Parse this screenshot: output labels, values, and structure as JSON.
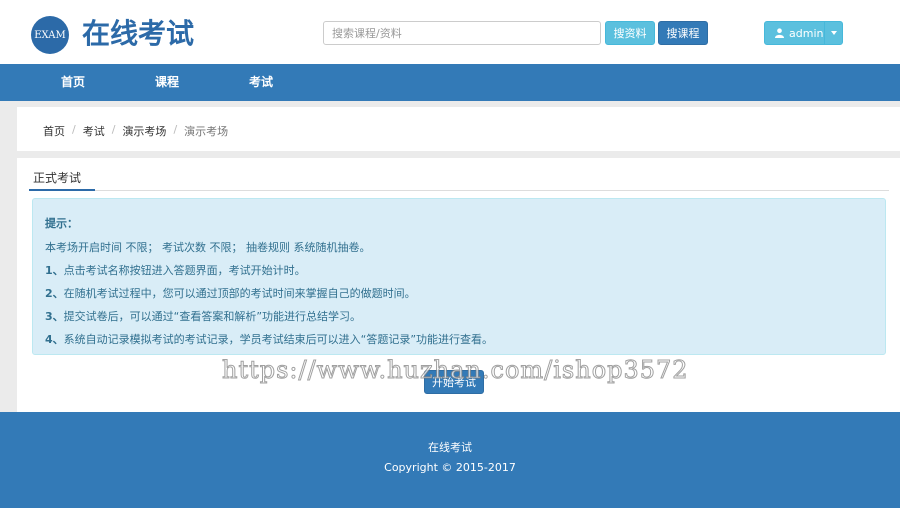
{
  "header": {
    "logo_badge": "EXAM",
    "logo_title": "在线考试",
    "search_placeholder": "搜索课程/资料",
    "search_resources_label": "搜资料",
    "search_courses_label": "搜课程",
    "user_name": "admin"
  },
  "nav": {
    "items": [
      {
        "label": "首页"
      },
      {
        "label": "课程"
      },
      {
        "label": "考试"
      }
    ]
  },
  "breadcrumb": [
    {
      "label": "首页"
    },
    {
      "label": "考试"
    },
    {
      "label": "演示考场"
    },
    {
      "label": "演示考场"
    }
  ],
  "tabs": {
    "active_label": "正式考试"
  },
  "notice": {
    "title": "提示：",
    "summary": "本考场开启时间 不限；  考试次数 不限；  抽卷规则 系统随机抽卷。",
    "items": [
      {
        "num": "1、",
        "text": "点击考试名称按钮进入答题界面，考试开始计时。"
      },
      {
        "num": "2、",
        "text": "在随机考试过程中，您可以通过顶部的考试时间来掌握自己的做题时间。"
      },
      {
        "num": "3、",
        "text": "提交试卷后，可以通过“查看答案和解析”功能进行总结学习。"
      },
      {
        "num": "4、",
        "text": "系统自动记录模拟考试的考试记录，学员考试结束后可以进入“答题记录”功能进行查看。"
      }
    ]
  },
  "start_button_label": "开始考试",
  "watermark": "https://www.huzhan.com/ishop3572",
  "footer": {
    "title": "在线考试",
    "copyright": "Copyright © 2015-2017"
  },
  "colors": {
    "primary": "#337ab7",
    "logo": "#2c6aa8",
    "info": "#5bc0de",
    "notice_bg": "#d9edf7",
    "notice_text": "#31708f"
  }
}
